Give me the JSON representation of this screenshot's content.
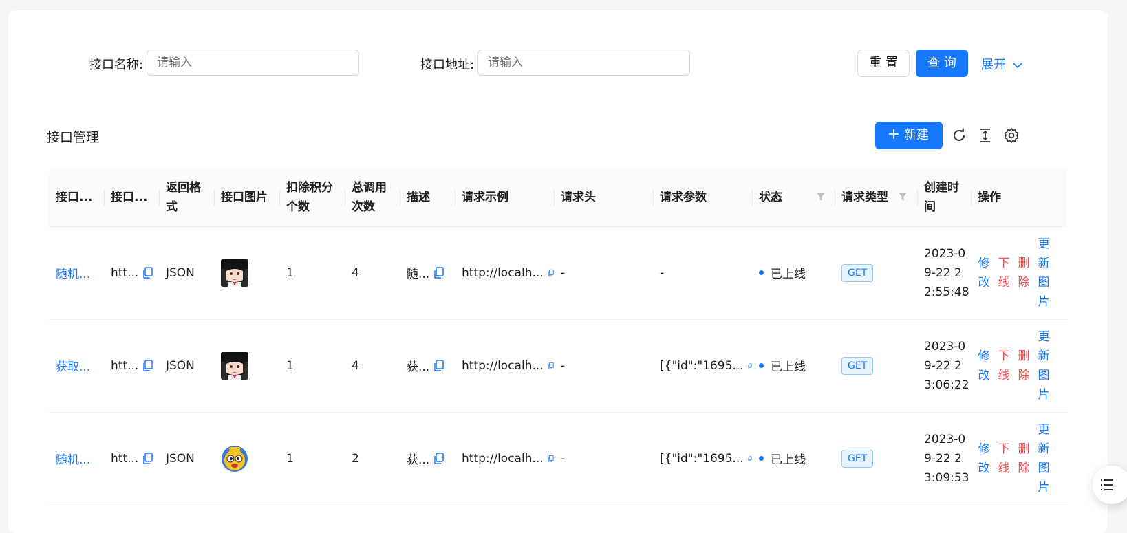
{
  "search": {
    "name_label": "接口名称:",
    "name_placeholder": "请输入",
    "url_label": "接口地址:",
    "url_placeholder": "请输入",
    "reset_label": "重 置",
    "query_label": "查 询",
    "expand_label": "展开"
  },
  "toolbar": {
    "title": "接口管理",
    "new_label": "新建"
  },
  "table": {
    "headers": {
      "name": "接口...",
      "url": "接口...",
      "format": "返回格式",
      "image": "接口图片",
      "points": "扣除积分个数",
      "calls": "总调用次数",
      "desc": "描述",
      "example": "请求示例",
      "req_header": "请求头",
      "params": "请求参数",
      "status": "状态",
      "method": "请求类型",
      "created": "创建时间",
      "actions": "操作"
    },
    "rows": [
      {
        "name": "随机...",
        "url": "htt...",
        "format": "JSON",
        "image": "anime-girl",
        "points": "1",
        "calls": "4",
        "desc": "随...",
        "example": "http://localh...",
        "req_header": "-",
        "params": "-",
        "status": "已上线",
        "method": "GET",
        "created": "2023-09-22 22:55:48"
      },
      {
        "name": "获取...",
        "url": "htt...",
        "format": "JSON",
        "image": "anime-girl",
        "points": "1",
        "calls": "4",
        "desc": "获...",
        "example": "http://localh...",
        "req_header": "-",
        "params": "[{\"id\":\"1695...",
        "status": "已上线",
        "method": "GET",
        "created": "2023-09-22 23:06:22"
      },
      {
        "name": "随机...",
        "url": "htt...",
        "format": "JSON",
        "image": "cartoon-emoji",
        "points": "1",
        "calls": "2",
        "desc": "获...",
        "example": "http://localh...",
        "req_header": "-",
        "params": "[{\"id\":\"1695...",
        "status": "已上线",
        "method": "GET",
        "created": "2023-09-22 23:09:53"
      }
    ],
    "actions": {
      "edit": "修改",
      "offline": "下线",
      "delete": "删除",
      "update_image": "更新图片"
    }
  },
  "colors": {
    "primary": "#1677ff",
    "danger": "#ff4d4f"
  }
}
